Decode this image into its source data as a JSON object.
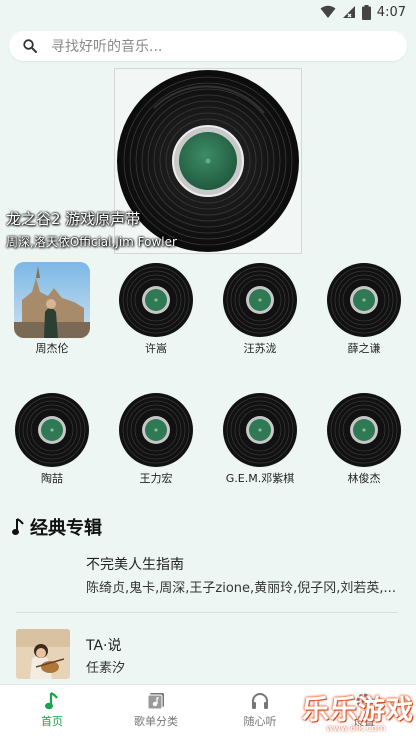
{
  "status_bar": {
    "time": "4:07"
  },
  "search": {
    "placeholder": "寻找好听的音乐..."
  },
  "banner": {
    "title": "龙之谷2 游戏原声带",
    "subtitle": "周深,洛天依Official,Jim Fowler"
  },
  "artists": [
    {
      "name": "周杰伦",
      "cover": "photo"
    },
    {
      "name": "许嵩",
      "cover": "vinyl"
    },
    {
      "name": "汪苏泷",
      "cover": "vinyl"
    },
    {
      "name": "薛之谦",
      "cover": "vinyl"
    },
    {
      "name": "陶喆",
      "cover": "vinyl"
    },
    {
      "name": "王力宏",
      "cover": "vinyl"
    },
    {
      "name": "G.E.M.邓紫棋",
      "cover": "vinyl"
    },
    {
      "name": "林俊杰",
      "cover": "vinyl"
    }
  ],
  "section": {
    "title": "经典专辑",
    "icon": "music-note-icon"
  },
  "albums": [
    {
      "name": "不完美人生指南",
      "artist": "陈绮贞,鬼卡,周深,王子zione,黄丽玲,倪子冈,刘若英,..."
    },
    {
      "name": "TA·说",
      "artist": "任素汐"
    }
  ],
  "nav": [
    {
      "label": "首页",
      "icon": "music-note-icon",
      "active": true
    },
    {
      "label": "歌单分类",
      "icon": "playlist-icon",
      "active": false
    },
    {
      "label": "随心听",
      "icon": "headphones-icon",
      "active": false
    },
    {
      "label": "设置",
      "icon": "gear-icon",
      "active": false
    }
  ],
  "watermark": {
    "text": "乐乐游戏",
    "url": "www.6lk.com"
  },
  "colors": {
    "accent": "#1aa34a",
    "background": "#eef6f3",
    "vinyl_label": "#2f7a55"
  }
}
